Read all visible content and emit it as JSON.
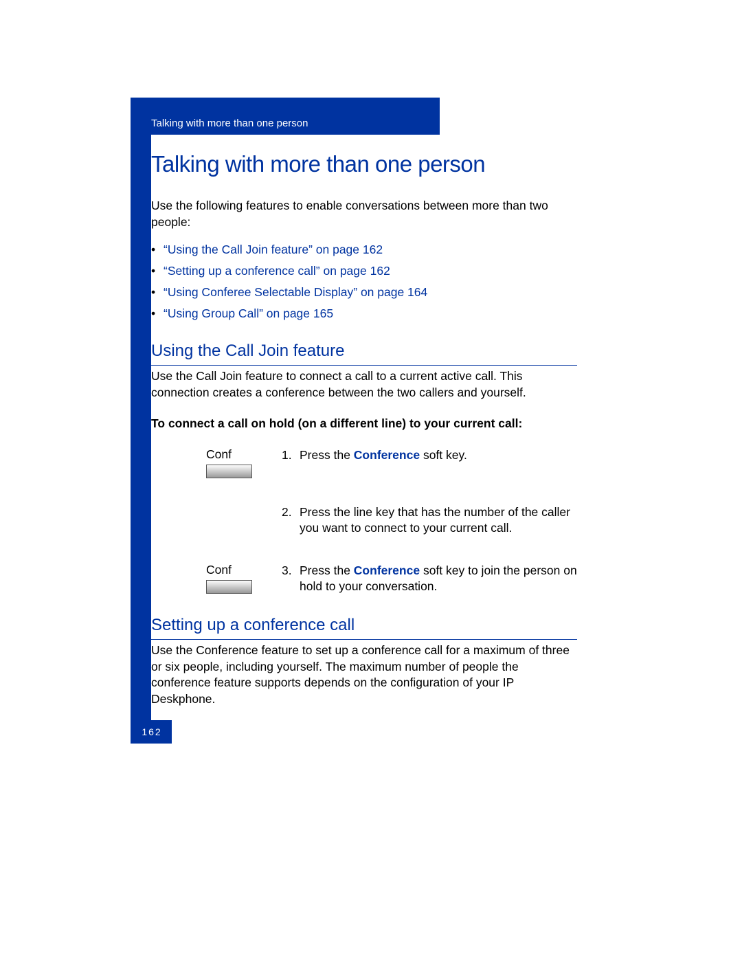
{
  "header": {
    "running_head": "Talking with more than one person"
  },
  "title": "Talking with more than one person",
  "intro": "Use the following features to enable conversations between more than two people:",
  "links": [
    "“Using the Call Join feature” on page 162",
    "“Setting up a conference call” on page 162",
    "“Using Conferee Selectable Display” on page 164",
    "“Using Group Call” on page 165"
  ],
  "section1": {
    "heading": "Using the Call Join feature",
    "body": "Use the Call Join feature to connect a call to a current active call. This connection creates a conference between the two callers and yourself.",
    "lead": "To connect a call on hold (on a different line) to your current call:",
    "steps": [
      {
        "left_label": "Conf",
        "has_button": true,
        "num": "1.",
        "text_pre": "Press the ",
        "kw": "Conference",
        "text_post": " soft key."
      },
      {
        "left_label": "",
        "has_button": false,
        "num": "2.",
        "text_pre": "Press the line key that has the number of the caller you want to connect to your current call.",
        "kw": "",
        "text_post": ""
      },
      {
        "left_label": "Conf",
        "has_button": true,
        "num": "3.",
        "text_pre": "Press the ",
        "kw": "Conference",
        "text_post": " soft key to join the person on hold to your conversation."
      }
    ]
  },
  "section2": {
    "heading": "Setting up a conference call",
    "body": "Use the Conference feature to set up a conference call for a maximum of three or six people, including yourself. The maximum number of people the conference feature supports depends on the configuration of your IP Deskphone."
  },
  "page_number": "162"
}
